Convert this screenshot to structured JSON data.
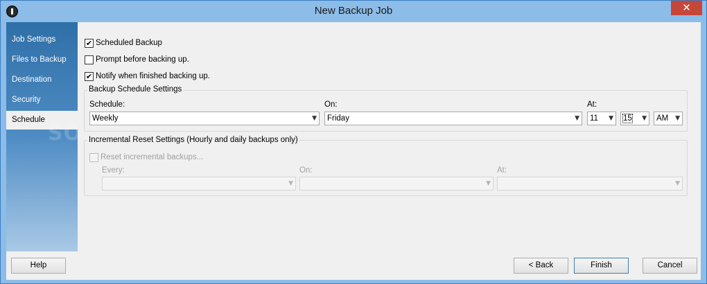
{
  "window": {
    "title": "New Backup Job",
    "close_glyph": "✕"
  },
  "sidebar": {
    "items": [
      {
        "label": "Job Settings"
      },
      {
        "label": "Files to Backup"
      },
      {
        "label": "Destination"
      },
      {
        "label": "Security"
      },
      {
        "label": "Schedule",
        "active": true
      }
    ]
  },
  "options": {
    "scheduled_backup": {
      "label": "Scheduled Backup",
      "checked": true
    },
    "prompt_before": {
      "label": "Prompt before backing up.",
      "checked": false
    },
    "notify_finished": {
      "label": "Notify when finished backing up.",
      "checked": true
    }
  },
  "schedule_settings": {
    "title": "Backup Schedule Settings",
    "schedule_label": "Schedule:",
    "schedule_value": "Weekly",
    "on_label": "On:",
    "on_value": "Friday",
    "at_label": "At:",
    "hour_value": "11",
    "minute_value": "15",
    "ampm_value": "AM"
  },
  "incremental_settings": {
    "title": "Incremental Reset Settings (Hourly and daily backups only)",
    "reset_label": "Reset incremental backups...",
    "reset_checked": false,
    "every_label": "Every:",
    "on_label": "On:",
    "at_label": "At:"
  },
  "buttons": {
    "help": "Help",
    "back": "< Back",
    "finish": "Finish",
    "cancel": "Cancel"
  },
  "watermark": "SOFTPEDIA",
  "colors": {
    "title_bar": "#8cbce8",
    "close_button": "#c7463a",
    "sidebar_top": "#2f6fa7",
    "panel_bg": "#f0f0f0"
  }
}
